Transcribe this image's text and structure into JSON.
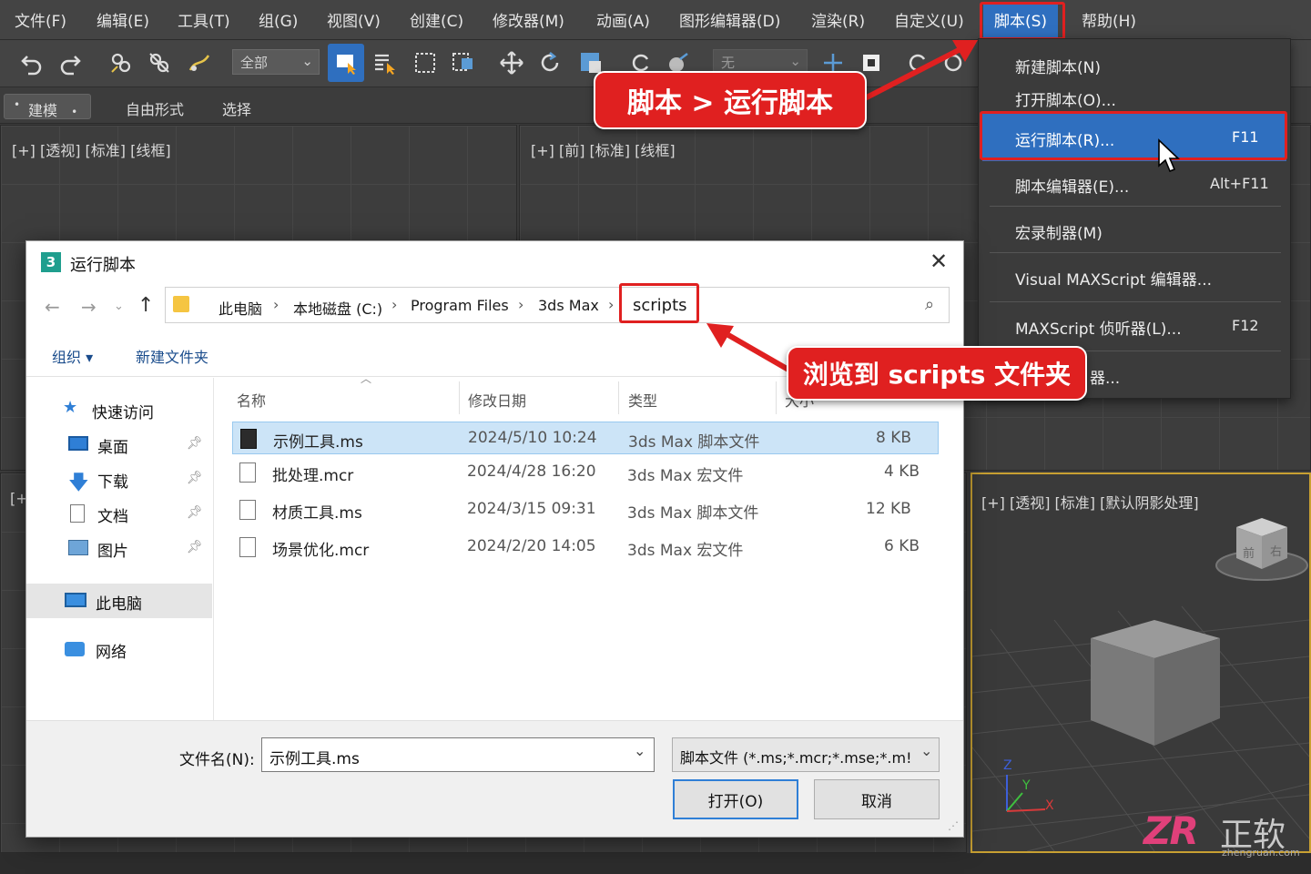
{
  "menubar": {
    "items": [
      "文件(F)",
      "编辑(E)",
      "工具(T)",
      "组(G)",
      "视图(V)",
      "创建(C)",
      "修改器(M)",
      "动画(A)",
      "图形编辑器(D)",
      "渲染(R)",
      "自定义(U)",
      "脚本(S)",
      "帮助(H)"
    ]
  },
  "toolbar": {
    "selection_filter": "全部",
    "coord_dropdown": "无"
  },
  "ribbon": {
    "tabs": [
      "建模",
      "自由形式",
      "选择"
    ]
  },
  "viewports": {
    "top_left_label": "[+] [透视] [标准] [线框]",
    "top_right_label": "[+] [前] [标准] [线框]",
    "bottom_left_label": "[+",
    "bottom_right_label": "[+] [透视] [标准] [默认阴影处理]",
    "viewcube_front": "前",
    "viewcube_right": "右",
    "axis_x": "X",
    "axis_y": "Y",
    "axis_z": "Z"
  },
  "script_menu": {
    "items": [
      {
        "label": "新建脚本(N)",
        "shortcut": ""
      },
      {
        "label": "打开脚本(O)...",
        "shortcut": ""
      },
      {
        "label": "运行脚本(R)...",
        "shortcut": "F11"
      },
      {
        "label": "脚本编辑器(E)...",
        "shortcut": "Alt+F11"
      },
      {
        "label": "宏录制器(M)",
        "shortcut": ""
      },
      {
        "label": "Visual MAXScript 编辑器...",
        "shortcut": ""
      },
      {
        "label": "MAXScript 侦听器(L)...",
        "shortcut": "F12"
      },
      {
        "label": "器...",
        "shortcut": ""
      }
    ]
  },
  "dialog": {
    "title": "运行脚本",
    "app_icon_text": "3",
    "breadcrumb": [
      "此电脑",
      "本地磁盘 (C:)",
      "Program Files",
      "3ds Max",
      "scripts"
    ],
    "toolbar": {
      "organize": "组织 ▾",
      "new_folder": "新建文件夹"
    },
    "nav": [
      {
        "label": "快速访问"
      },
      {
        "label": "桌面"
      },
      {
        "label": "下载"
      },
      {
        "label": "文档"
      },
      {
        "label": "图片"
      },
      {
        "label": "此电脑"
      },
      {
        "label": "网络"
      }
    ],
    "columns": [
      "名称",
      "修改日期",
      "类型",
      "大小"
    ],
    "files": [
      {
        "name": "示例工具.ms",
        "date": "2024/5/10 10:24",
        "type": "3ds Max 脚本文件",
        "size": "8 KB"
      },
      {
        "name": "批处理.mcr",
        "date": "2024/4/28 16:20",
        "type": "3ds Max 宏文件",
        "size": "4 KB"
      },
      {
        "name": "材质工具.ms",
        "date": "2024/3/15 09:31",
        "type": "3ds Max 脚本文件",
        "size": "12 KB"
      },
      {
        "name": "场景优化.mcr",
        "date": "2024/2/20 14:05",
        "type": "3ds Max 宏文件",
        "size": "6 KB"
      }
    ],
    "filename_label": "文件名(N):",
    "filename_value": "示例工具.ms",
    "filetype_value": "脚本文件 (*.ms;*.mcr;*.mse;*.m!",
    "open_button": "打开(O)",
    "cancel_button": "取消"
  },
  "annotations": {
    "callout_menu": "脚本 > 运行脚本",
    "callout_folder": "浏览到 scripts 文件夹"
  },
  "watermark": {
    "brand": "正软",
    "url": "zhengruan.com",
    "logo": "ZR"
  },
  "colors": {
    "accent_red": "#e02020",
    "menu_highlight": "#2f6fbf",
    "selected_row": "#cce4f7"
  }
}
